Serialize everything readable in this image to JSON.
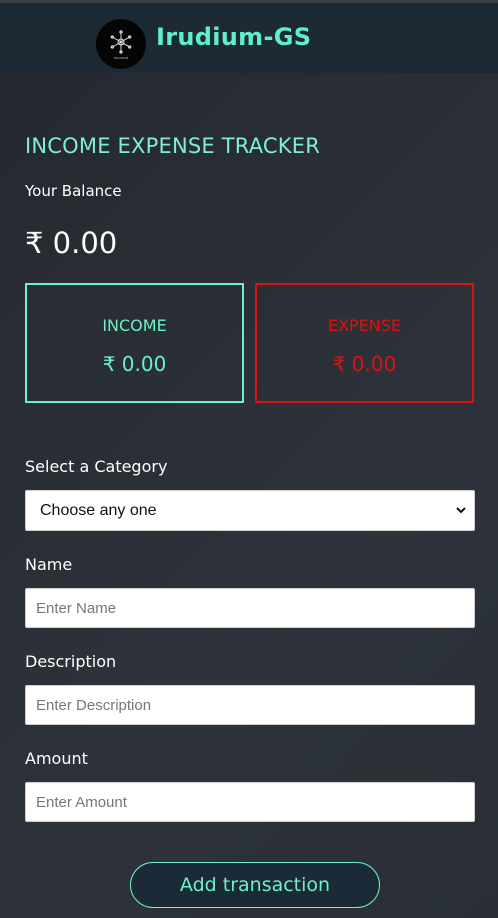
{
  "header": {
    "brand": "Irudium-GS",
    "logo_icon": "snowflake-logo-icon",
    "logo_text": "IRUDIUM"
  },
  "tracker": {
    "title": "INCOME EXPENSE TRACKER",
    "balance_label": "Your Balance",
    "balance_value": "₹ 0.00"
  },
  "cards": {
    "income_label": "INCOME",
    "income_value": "₹ 0.00",
    "expense_label": "EXPENSE",
    "expense_value": "₹ 0.00",
    "income_color": "#6cf1c9",
    "expense_color": "#e01010"
  },
  "form": {
    "category_label": "Select a Category",
    "category_selected": "Choose any one",
    "name_label": "Name",
    "name_placeholder": "Enter Name",
    "description_label": "Description",
    "description_placeholder": "Enter Description",
    "amount_label": "Amount",
    "amount_placeholder": "Enter Amount",
    "submit_label": "Add transaction"
  },
  "colors": {
    "accent": "#6cf1c9",
    "header_bg": "#1d2a36",
    "page_bg": "#2b3038"
  }
}
